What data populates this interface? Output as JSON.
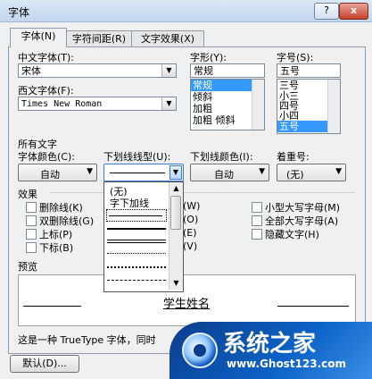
{
  "window": {
    "title": "字体",
    "help_label": "?",
    "close_label": "x"
  },
  "tabs": [
    {
      "label": "字体(N)"
    },
    {
      "label": "字符间距(R)"
    },
    {
      "label": "文字效果(X)"
    }
  ],
  "font": {
    "cn_label": "中文字体(T):",
    "cn_value": "宋体",
    "west_label": "西文字体(F):",
    "west_value": "Times New Roman",
    "style_label": "字形(Y):",
    "style_value": "常规",
    "style_list": [
      "常规",
      "倾斜",
      "加粗",
      "加粗 倾斜"
    ],
    "size_label": "字号(S):",
    "size_value": "五号",
    "size_list": [
      "三号",
      "小三",
      "四号",
      "小四",
      "五号"
    ]
  },
  "all_text": {
    "section_label": "所有文字",
    "color_label": "字体颜色(C):",
    "color_value": "自动",
    "underline_label": "下划线线型(U):",
    "underline_color_label": "下划线颜色(I):",
    "underline_color_value": "自动",
    "emphasis_label": "着重号:",
    "emphasis_value": "(无)"
  },
  "underline_popup": {
    "none_label": "(无)",
    "word_label": "字下加线"
  },
  "effects": {
    "section_label": "效果",
    "left": [
      "删除线(K)",
      "双删除线(G)",
      "上标(P)",
      "下标(B)"
    ],
    "mid_fragments": [
      "(W)",
      "(O)",
      "(E)",
      "(V)"
    ],
    "right": [
      "小型大写字母(M)",
      "全部大写字母(A)",
      "隐藏文字(H)"
    ]
  },
  "preview": {
    "section_label": "预览",
    "sample": "学生姓名",
    "desc": "这是一种 TrueType 字体，同时"
  },
  "buttons": {
    "default_label": "默认(D)..."
  },
  "watermark": {
    "brand": "系统之家",
    "url": "www.Ghost123.com"
  }
}
